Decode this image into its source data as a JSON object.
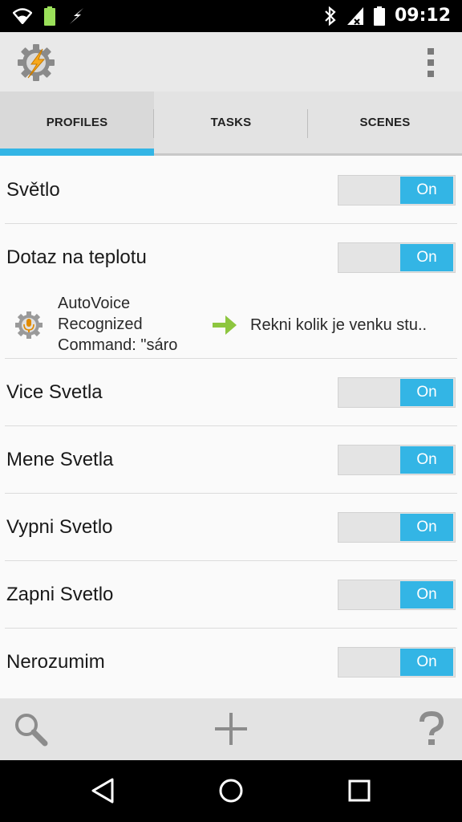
{
  "status_bar": {
    "time": "09:12",
    "icons": [
      "wifi-icon",
      "battery-icon",
      "flash-icon",
      "bluetooth-icon",
      "signal-off-icon",
      "battery-full-icon"
    ]
  },
  "action_bar": {
    "logo_icon": "tasker-gear-bolt-icon",
    "overflow_icon": "overflow-menu-icon"
  },
  "tabs": [
    {
      "label": "PROFILES",
      "active": true
    },
    {
      "label": "TASKS",
      "active": false
    },
    {
      "label": "SCENES",
      "active": false
    }
  ],
  "profiles": [
    {
      "name": "Světlo",
      "toggle": "On"
    },
    {
      "name": "Dotaz na teplotu",
      "toggle": "On",
      "context": {
        "icon": "autovoice-mic-icon",
        "text": "AutoVoice Recognized Command: \"sáro",
        "task": "Rekni kolik je venku stu.."
      }
    },
    {
      "name": "Vice Svetla",
      "toggle": "On"
    },
    {
      "name": "Mene Svetla",
      "toggle": "On"
    },
    {
      "name": "Vypni Svetlo",
      "toggle": "On"
    },
    {
      "name": "Zapni Svetlo",
      "toggle": "On"
    },
    {
      "name": "Nerozumim",
      "toggle": "On"
    }
  ],
  "bottom_bar": {
    "icons": [
      "search-icon",
      "add-icon",
      "help-icon"
    ]
  },
  "nav_bar": {
    "icons": [
      "back-icon",
      "home-icon",
      "recents-icon"
    ]
  },
  "colors": {
    "accent": "#33b5e5",
    "arrow": "#8dc63f"
  }
}
